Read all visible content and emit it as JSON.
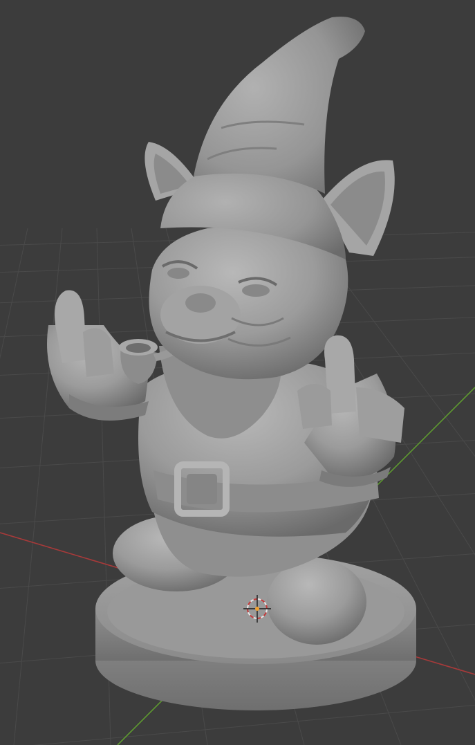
{
  "viewport": {
    "kind": "3d-viewport",
    "background": "#3c3c3c",
    "grid_color": "#474747",
    "axis_x_color": "#a83a3a",
    "axis_y_color": "#5e9a2f"
  },
  "scene": {
    "object": {
      "icon": "sculpt-mesh",
      "surface_color": "#9b9b9b",
      "shadow_color": "#5a5a5a"
    },
    "cursor": {
      "icon": "3d-cursor",
      "ring_color_a": "#c43a3a",
      "ring_color_b": "#e8e8e8"
    }
  }
}
